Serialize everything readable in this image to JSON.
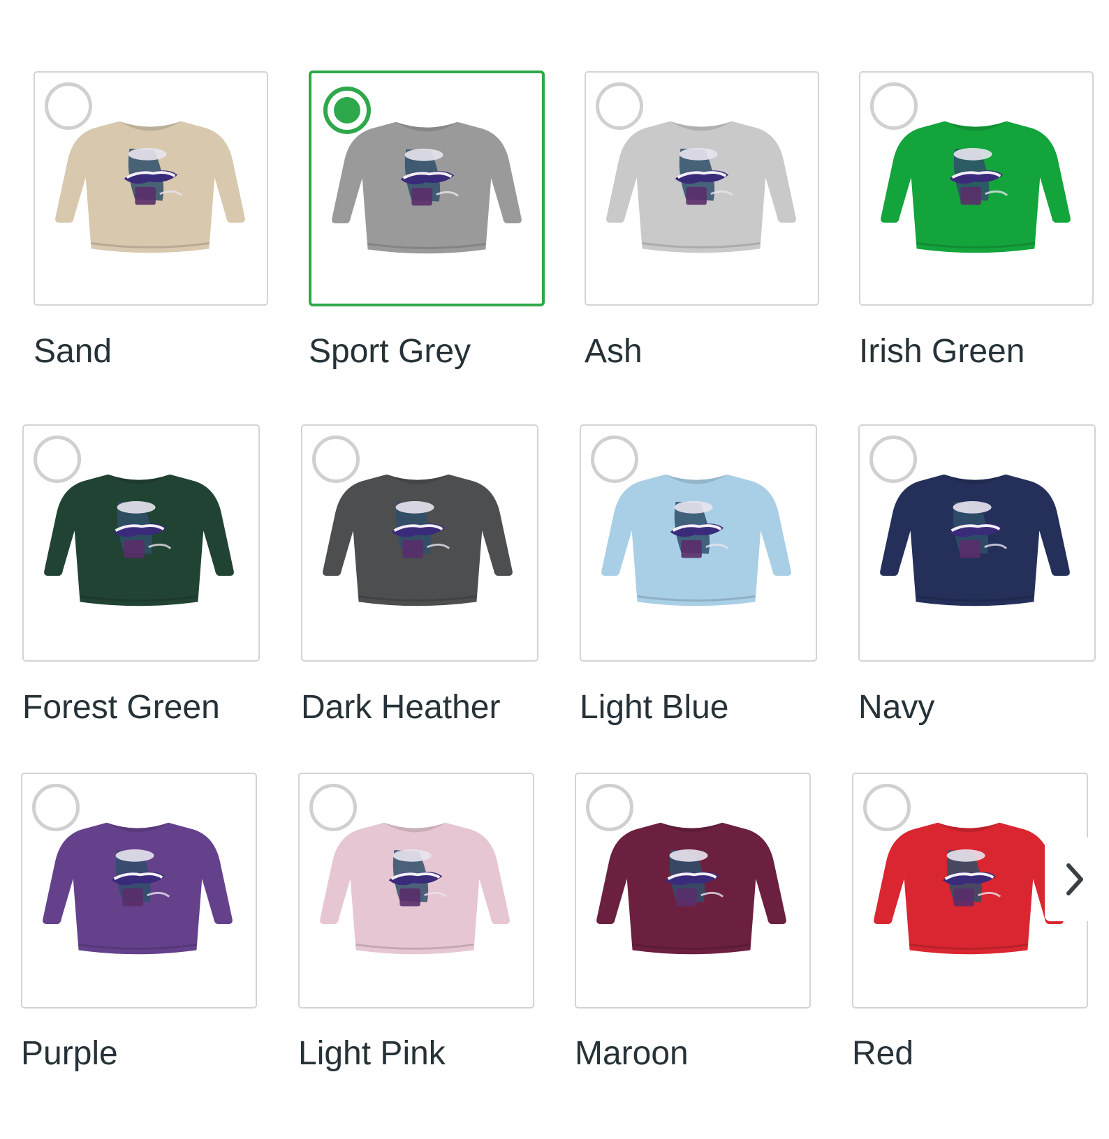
{
  "swatches": [
    {
      "label": "Sand",
      "color": "#d7c8ae",
      "selected": false
    },
    {
      "label": "Sport Grey",
      "color": "#9a9a9a",
      "selected": true
    },
    {
      "label": "Ash",
      "color": "#c9c9c9",
      "selected": false
    },
    {
      "label": "Irish Green",
      "color": "#14a43c",
      "selected": false
    },
    {
      "label": "Forest Green",
      "color": "#214334",
      "selected": false
    },
    {
      "label": "Dark Heather",
      "color": "#4c4e4f",
      "selected": false
    },
    {
      "label": "Light Blue",
      "color": "#a9cfe6",
      "selected": false
    },
    {
      "label": "Navy",
      "color": "#25305a",
      "selected": false
    },
    {
      "label": "Purple",
      "color": "#65418c",
      "selected": false
    },
    {
      "label": "Light Pink",
      "color": "#e6c6d3",
      "selected": false
    },
    {
      "label": "Maroon",
      "color": "#6c2040",
      "selected": false
    },
    {
      "label": "Red",
      "color": "#d92630",
      "selected": false
    }
  ],
  "icons": {
    "next": "chevron-right-icon",
    "radio": "radio-circle-icon"
  },
  "accent_color": "#2ea84a"
}
